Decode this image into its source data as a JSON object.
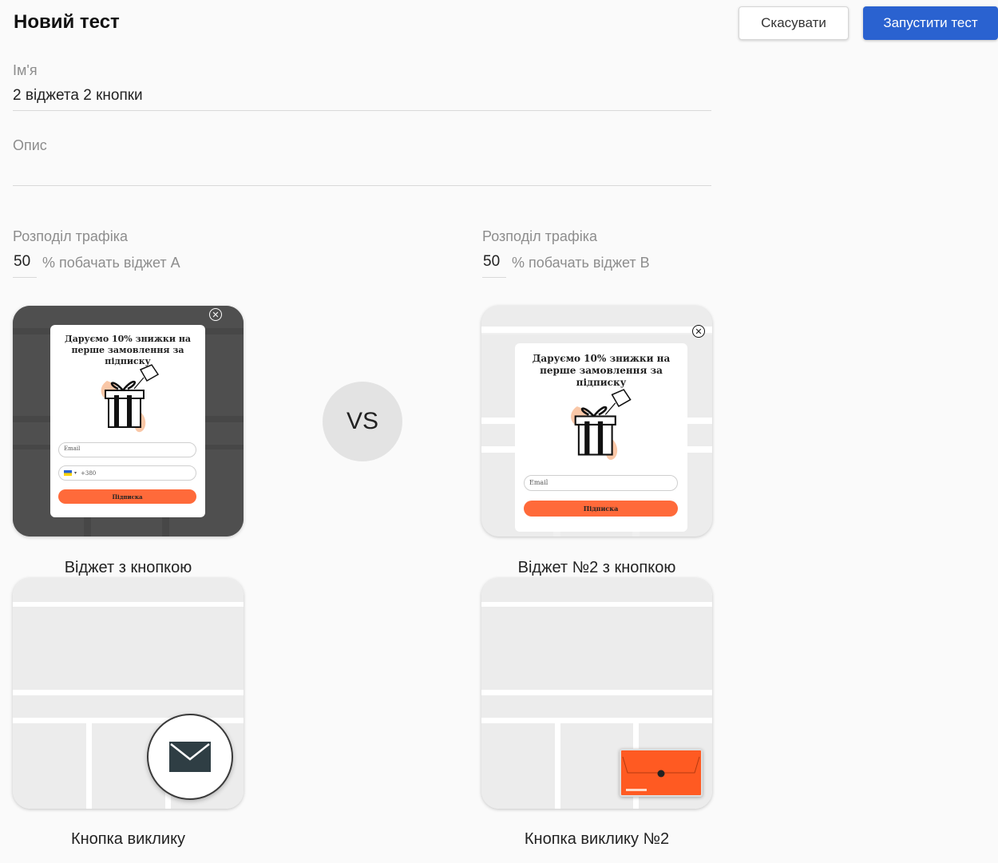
{
  "header": {
    "title": "Новий тест",
    "cancel_label": "Скасувати",
    "run_label": "Запустити тест"
  },
  "form": {
    "name_label": "Ім'я",
    "name_value": "2 віджета 2 кнопки",
    "description_label": "Опис",
    "description_value": ""
  },
  "traffic": {
    "a": {
      "label": "Розподіл трафіка",
      "value": "50",
      "suffix": "% побачать віджет A"
    },
    "b": {
      "label": "Розподіл трафіка",
      "value": "50",
      "suffix": "% побачать віджет B"
    }
  },
  "vs_label": "VS",
  "widgets": [
    {
      "caption": "Віджет з кнопкою",
      "popup_title": "Даруємо 10% знижки на перше замовлення за підписку",
      "email_placeholder": "Email",
      "phone_value": "+380",
      "submit_label": "Підписка"
    },
    {
      "caption": "Віджет №2 з кнопкою",
      "popup_title": "Даруємо 10% знижки на перше замовлення за підписку",
      "email_placeholder": "Email",
      "submit_label": "Підписка"
    }
  ],
  "buttons": [
    {
      "caption": "Кнопка виклику",
      "icon": "envelope-icon"
    },
    {
      "caption": "Кнопка виклику №2",
      "icon": "orange-envelope-icon"
    }
  ],
  "colors": {
    "primary": "#2a62d0",
    "accent": "#ff6a3a",
    "dark_overlay": "#474747"
  }
}
